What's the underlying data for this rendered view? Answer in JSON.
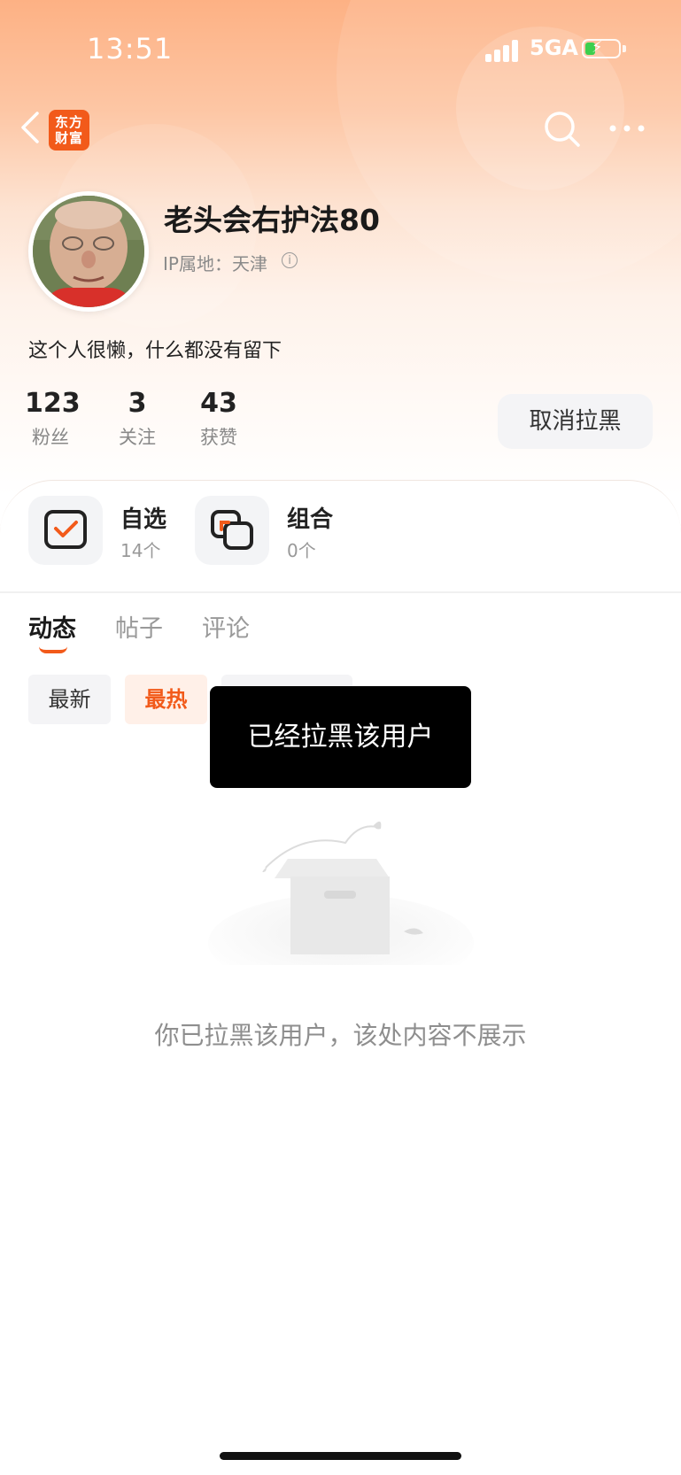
{
  "status_bar": {
    "time": "13:51",
    "network": "5GA"
  },
  "nav": {
    "logo_line1": "东方",
    "logo_line2": "财富"
  },
  "profile": {
    "username": "老头会右护法80",
    "ip_location": "IP属地：天津",
    "bio": "这个人很懒，什么都没有留下",
    "stats": [
      {
        "value": "123",
        "label": "粉丝"
      },
      {
        "value": "3",
        "label": "关注"
      },
      {
        "value": "43",
        "label": "获赞"
      }
    ],
    "unblock_label": "取消拉黑"
  },
  "assets": {
    "watchlist": {
      "title": "自选",
      "count": "14个"
    },
    "portfolio": {
      "title": "组合",
      "count": "0个"
    }
  },
  "tabs": [
    {
      "label": "动态",
      "active": true
    },
    {
      "label": "帖子",
      "active": false
    },
    {
      "label": "评论",
      "active": false
    }
  ],
  "filters": [
    {
      "label": "最新"
    },
    {
      "label": "最热"
    }
  ],
  "toast": "已经拉黑该用户",
  "empty_message": "你已拉黑该用户，该处内容不展示",
  "colors": {
    "accent": "#f25a1a",
    "header_top": "#fdb184"
  }
}
